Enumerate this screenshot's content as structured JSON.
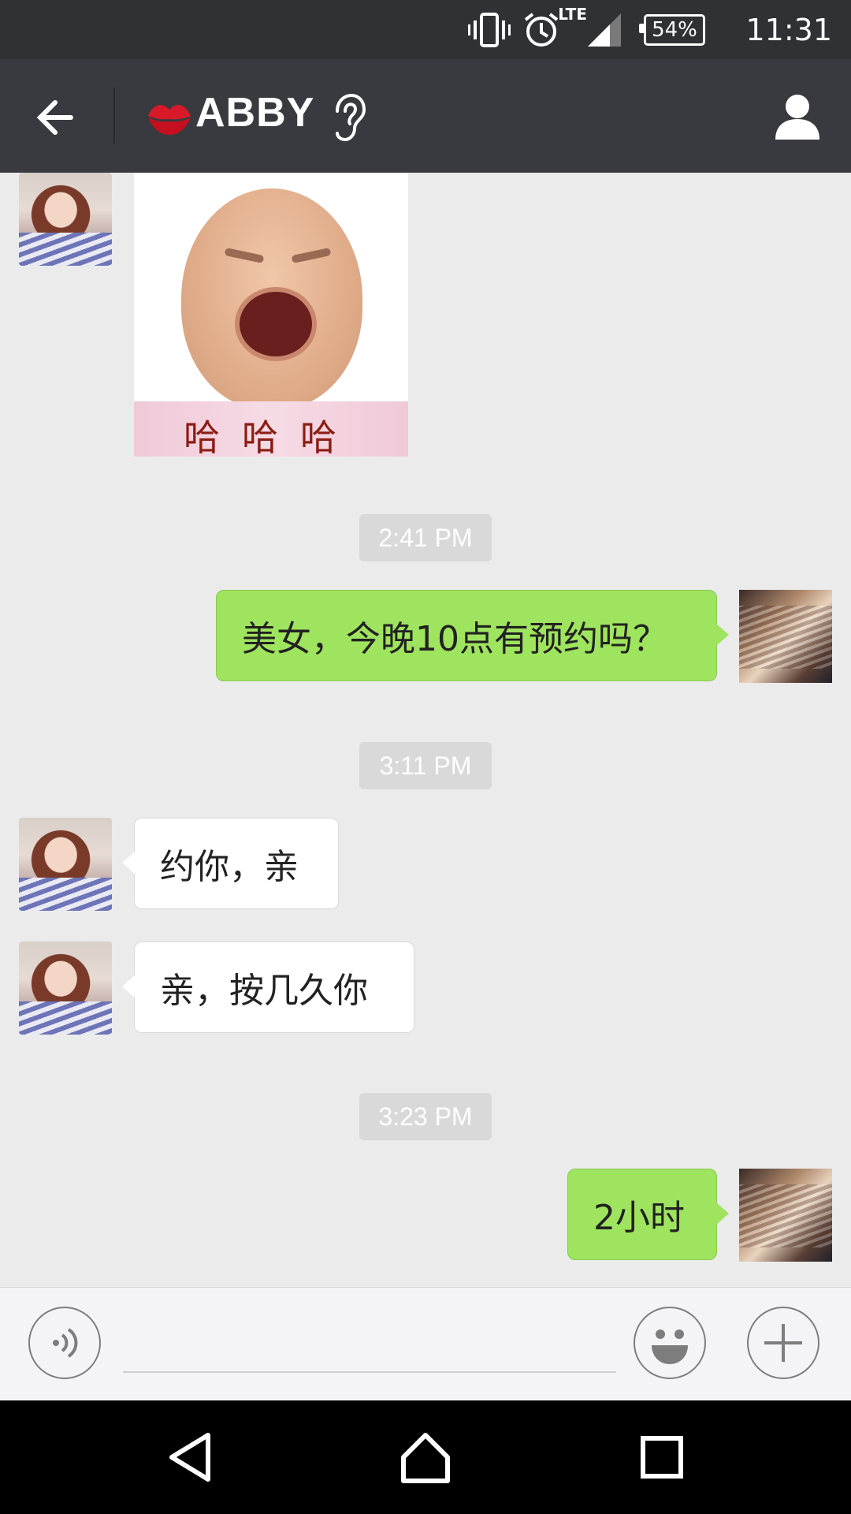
{
  "status_bar": {
    "network": "LTE",
    "battery": "54%",
    "time": "11:31"
  },
  "header": {
    "title": "ABBY"
  },
  "messages": [
    {
      "type": "sticker",
      "side": "left",
      "sticker_text": "哈哈哈"
    },
    {
      "type": "timestamp",
      "text": "2:41 PM"
    },
    {
      "type": "text",
      "side": "right",
      "text": "美女，今晚10点有预约吗？"
    },
    {
      "type": "timestamp",
      "text": "3:11 PM"
    },
    {
      "type": "text",
      "side": "left",
      "text": "约你，亲"
    },
    {
      "type": "text",
      "side": "left",
      "text": "亲，按几久你"
    },
    {
      "type": "timestamp",
      "text": "3:23 PM"
    },
    {
      "type": "text",
      "side": "right",
      "text": "2小时"
    }
  ],
  "input": {
    "placeholder": "",
    "value": ""
  },
  "colors": {
    "status_bar_bg": "#2f3134",
    "toolbar_bg": "#393a3f",
    "chat_bg": "#ebebeb",
    "outgoing_bubble": "#9fe45e",
    "incoming_bubble": "#ffffff",
    "timestamp_bg": "#d9d9d9"
  },
  "icons": [
    "vibrate-icon",
    "alarm-icon",
    "signal-icon",
    "battery-icon",
    "back-arrow-icon",
    "lips-icon",
    "ear-icon",
    "profile-icon",
    "voice-icon",
    "emoji-icon",
    "plus-icon",
    "nav-back-icon",
    "nav-home-icon",
    "nav-recents-icon"
  ]
}
